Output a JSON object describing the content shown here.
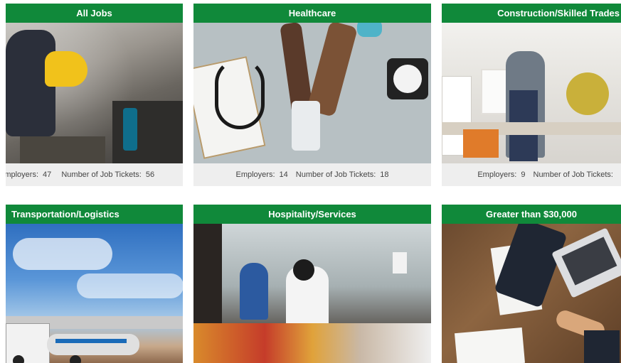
{
  "cards": [
    {
      "title": "All Jobs",
      "employers_label": "Employers:",
      "employers": "47",
      "tickets_label": "Number of Job Tickets:",
      "tickets": "56",
      "image": "welder-workshop"
    },
    {
      "title": "Healthcare",
      "employers_label": "Employers:",
      "employers": "14",
      "tickets_label": "Number of Job Tickets:",
      "tickets": "18",
      "image": "blood-pressure-check"
    },
    {
      "title": "Construction/Skilled Trades",
      "employers_label": "Employers:",
      "employers": "9",
      "tickets_label": "Number of Job Tickets:",
      "tickets": "",
      "image": "carpenter-saw"
    },
    {
      "title": "Transportation/Logistics",
      "image": "tanker-trucks"
    },
    {
      "title": "Hospitality/Services",
      "image": "banquet-service"
    },
    {
      "title": "Greater than $30,000",
      "image": "business-handshake"
    }
  ],
  "accent": "#10893a"
}
